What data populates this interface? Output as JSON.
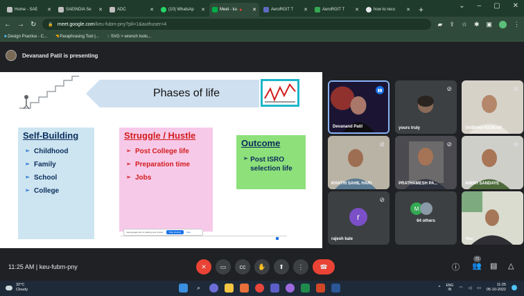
{
  "browser": {
    "tabs": [
      {
        "label": "Home - SAE",
        "color": "#e8eaed"
      },
      {
        "label": "SAEINDIA Se",
        "color": "#e8eaed"
      },
      {
        "label": "ADC",
        "color": "#e8eaed"
      },
      {
        "label": "(10) WhatsAp",
        "color": "#25d366"
      },
      {
        "label": "Meet - ku",
        "color": "#00ac47",
        "active": true
      },
      {
        "label": "AeroRGIT T",
        "color": "#5c6bc0"
      },
      {
        "label": "AeroRGIT T",
        "color": "#34a853"
      },
      {
        "label": "how to reco",
        "color": "#e8eaed"
      }
    ],
    "new_tab": "+",
    "window_controls": [
      "⌄",
      "–",
      "▢",
      "✕"
    ],
    "url_host": "meet.google.com",
    "url_path": "/keu-fubm-pny?pli=1&authuser=4",
    "bookmarks": [
      "Design Practice - C...",
      "Paraphrasing Tool |...",
      "SVG > wrench tools..."
    ]
  },
  "meet": {
    "presenter_text": "Devanand Patil is presenting",
    "meeting_time": "11:25 AM",
    "meeting_code": "keu-fubm-pny",
    "people_count": "71",
    "participants": [
      {
        "name": "Devanand Patil",
        "selected": true
      },
      {
        "name": "yours truly"
      },
      {
        "name": "VAIBHAV KESKAR"
      },
      {
        "name": "KHATRI SAHIL HARI"
      },
      {
        "name": "PRATHAMESH PA..."
      },
      {
        "name": "ANISH SANDAYE"
      },
      {
        "name": "rajesh kale",
        "initial": "r",
        "color": "#7b4fc7"
      },
      {
        "name": "64 others",
        "initial": "M",
        "color": "#34a853"
      },
      {
        "name": "You"
      }
    ]
  },
  "slide": {
    "title": "Phases of life",
    "self_building": {
      "heading": "Self-Building",
      "items": [
        "Childhood",
        "Family",
        "School",
        "College"
      ]
    },
    "struggle": {
      "heading": "Struggle / Hustle",
      "items": [
        "Post College life",
        "Preparation time",
        "Jobs"
      ]
    },
    "outcome": {
      "heading": "Outcome",
      "items": [
        "Post ISRO selection life"
      ]
    },
    "share_bar": {
      "text": "meet.google.com is sharing your screen.",
      "stop": "Stop sharing",
      "hide": "Hide"
    }
  },
  "taskbar": {
    "weather_temp": "32°C",
    "weather_desc": "Cloudy",
    "lang": "ENG",
    "lang_sub": "IN",
    "time": "11:25",
    "date": "05-10-2022"
  }
}
